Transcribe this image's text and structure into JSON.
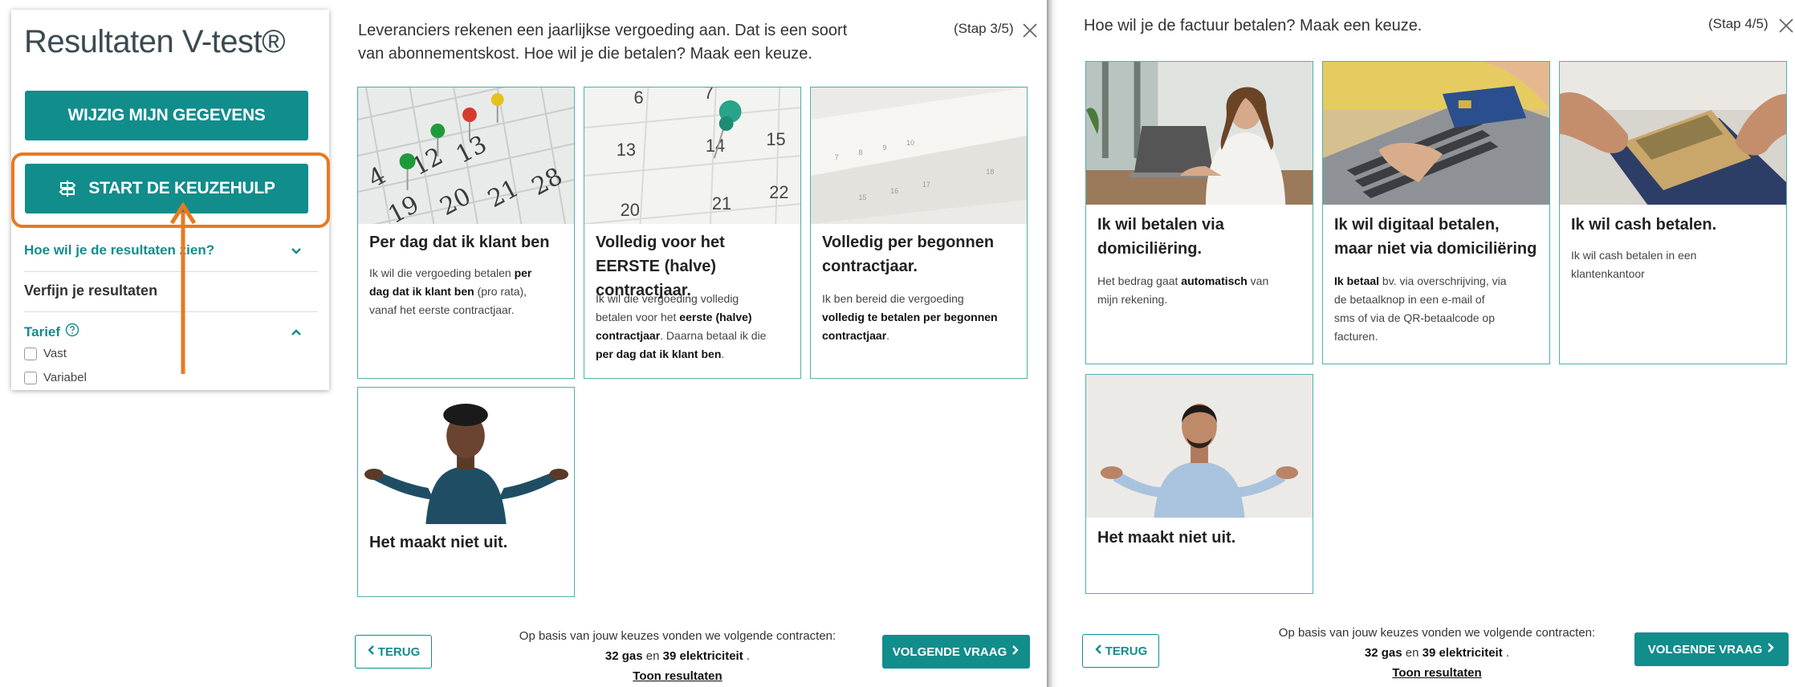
{
  "sidebar": {
    "title": "Resultaten V-test®",
    "edit_button": "WIJZIG MIJN GEGEVENS",
    "start_button": "START DE KEUZEHULP",
    "results_view_link": "Hoe wil je de resultaten zien?",
    "refine_heading": "Verfijn je resultaten",
    "tariff_label": "Tarief",
    "tariff_options": [
      "Vast",
      "Variabel"
    ],
    "colors": {
      "accent": "#118d8c",
      "highlight": "#e87a20"
    }
  },
  "step3": {
    "question": [
      "Leveranciers rekenen een jaarlijkse vergoeding aan. Dat is een soort",
      "van abonnementskost. Hoe wil je die betalen? Maak een keuze."
    ],
    "step_label": "(Stap 3/5)",
    "cards": [
      {
        "title": "Per dag dat ik klant ben",
        "image": "calendar-pins-photo",
        "lines": [
          [
            "Ik wil die vergoeding betalen ",
            {
              "b": "per"
            }
          ],
          [
            {
              "b": "dag dat ik klant ben"
            },
            " (pro rata),"
          ],
          [
            "vanaf het eerste contractjaar."
          ]
        ]
      },
      {
        "title": "Volledig voor het EERSTE (halve) contractjaar.",
        "image": "calendar-single-pin-photo",
        "lines": [
          [
            "Ik wil die vergoeding volledig"
          ],
          [
            "betalen voor het ",
            {
              "b": "eerste (halve)"
            }
          ],
          [
            {
              "b": "contractjaar"
            },
            ". Daarna betaal ik die"
          ],
          [
            {
              "b": "per dag dat ik klant ben"
            },
            "."
          ]
        ]
      },
      {
        "title": "Volledig per begonnen contractjaar.",
        "image": "calendar-pages-photo",
        "lines": [
          [
            "Ik ben bereid die vergoeding"
          ],
          [
            {
              "b": "volledig te betalen per begonnen"
            }
          ],
          [
            {
              "b": "contractjaar"
            },
            "."
          ]
        ]
      },
      {
        "title": "Het maakt niet uit.",
        "image": "shrugging-man-photo",
        "lines": []
      }
    ],
    "back_button": "TERUG",
    "next_button": "VOLGENDE VRAAG",
    "summary_line1": "Op basis van jouw keuzes vonden we volgende contracten:",
    "summary_count_gas": "32 gas",
    "summary_and": " en ",
    "summary_count_elec": "39 elektriciteit",
    "summary_end": " .",
    "summary_link": "Toon resultaten"
  },
  "step4": {
    "question": [
      "Hoe wil je de factuur betalen? Maak een keuze."
    ],
    "step_label": "(Stap 4/5)",
    "cards": [
      {
        "title": "Ik wil betalen via domiciliëring.",
        "image": "woman-laptop-photo",
        "lines": [
          [
            "Het bedrag gaat ",
            {
              "b": "automatisch"
            },
            " van"
          ],
          [
            "mijn rekening."
          ]
        ]
      },
      {
        "title": "Ik wil digitaal betalen, maar niet via domiciliëring",
        "image": "card-keyboard-photo",
        "lines": [
          [
            {
              "b": "Ik betaal"
            },
            " bv. via overschrijving, via"
          ],
          [
            "de betaalknop in een e-mail of"
          ],
          [
            "sms of via de QR-betaalcode op"
          ],
          [
            "facturen."
          ]
        ]
      },
      {
        "title": "Ik wil cash betalen.",
        "image": "cash-wallet-photo",
        "lines": [
          [
            "Ik wil cash betalen in een"
          ],
          [
            "klantenkantoor"
          ]
        ]
      },
      {
        "title": "Het maakt niet uit.",
        "image": "shrugging-man-shirt-photo",
        "lines": []
      }
    ],
    "back_button": "TERUG",
    "next_button": "VOLGENDE VRAAG",
    "summary_line1": "Op basis van jouw keuzes vonden we volgende contracten:",
    "summary_count_gas": "32 gas",
    "summary_and": " en ",
    "summary_count_elec": "39 elektriciteit",
    "summary_end": " .",
    "summary_link": "Toon resultaten"
  }
}
